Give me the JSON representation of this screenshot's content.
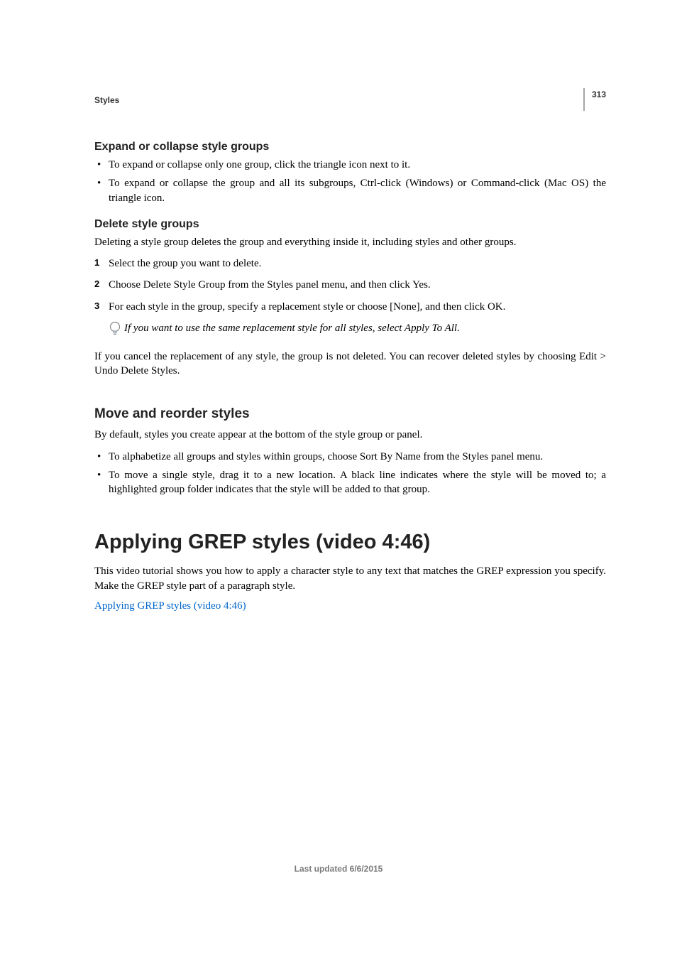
{
  "meta": {
    "page_number": "313",
    "chapter": "Styles",
    "footer": "Last updated 6/6/2015"
  },
  "sec_expand": {
    "title": "Expand or collapse style groups",
    "bullets": [
      "To expand or collapse only one group, click the triangle icon next to it.",
      "To expand or collapse the group and all its subgroups, Ctrl-click (Windows) or Command-click (Mac OS) the triangle icon."
    ]
  },
  "sec_delete": {
    "title": "Delete style groups",
    "intro": "Deleting a style group deletes the group and everything inside it, including styles and other groups.",
    "steps": [
      "Select the group you want to delete.",
      "Choose Delete Style Group from the Styles panel menu, and then click Yes.",
      "For each style in the group, specify a replacement style or choose [None], and then click OK."
    ],
    "tip": "If you want to use the same replacement style for all styles, select Apply To All.",
    "after": "If you cancel the replacement of any style, the group is not deleted. You can recover deleted styles by choosing Edit > Undo Delete Styles."
  },
  "sec_move": {
    "title": "Move and reorder styles",
    "intro": "By default, styles you create appear at the bottom of the style group or panel.",
    "bullets": [
      "To alphabetize all groups and styles within groups, choose Sort By Name from the Styles panel menu.",
      "To move a single style, drag it to a new location. A black line indicates where the style will be moved to; a highlighted group folder indicates that the style will be added to that group."
    ]
  },
  "sec_grep": {
    "title": "Applying GREP styles (video 4:46)",
    "body": "This video tutorial shows you how to apply a character style to any text that matches the GREP expression you specify. Make the GREP style part of a paragraph style.",
    "link": "Applying GREP styles (video 4:46)"
  }
}
